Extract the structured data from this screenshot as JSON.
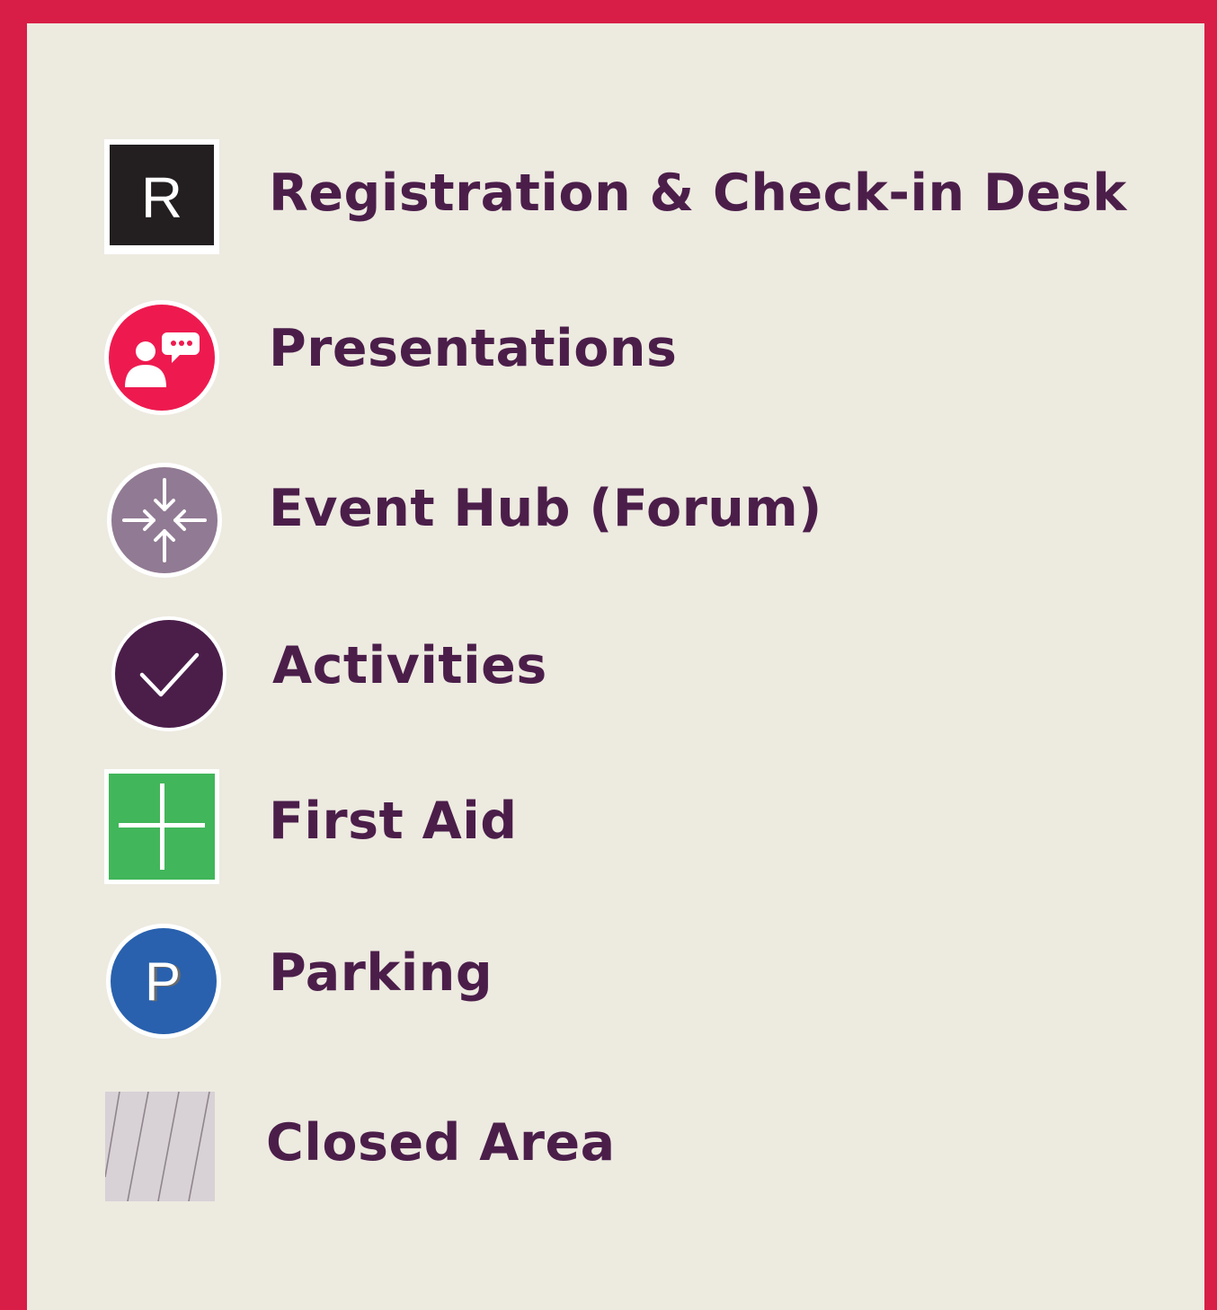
{
  "legend": {
    "items": [
      {
        "label": "Registration & Check-in Desk",
        "icon": "registration-icon",
        "icon_text": "R",
        "color": "#231f20"
      },
      {
        "label": "Presentations",
        "icon": "presentation-icon",
        "color": "#ee1a4f"
      },
      {
        "label": "Event Hub (Forum)",
        "icon": "hub-arrows-icon",
        "color": "#917a93"
      },
      {
        "label": "Activities",
        "icon": "checkmark-icon",
        "color": "#4b1e4a"
      },
      {
        "label": "First Aid",
        "icon": "first-aid-cross-icon",
        "color": "#41b65a"
      },
      {
        "label": "Parking",
        "icon": "parking-icon",
        "icon_text": "P",
        "color": "#2961ae"
      },
      {
        "label": "Closed Area",
        "icon": "closed-area-hatch-icon",
        "color": "#d8d1d6"
      }
    ]
  },
  "colors": {
    "border": "#d81e46",
    "panel": "#edeae0",
    "text": "#4b1e4a"
  }
}
